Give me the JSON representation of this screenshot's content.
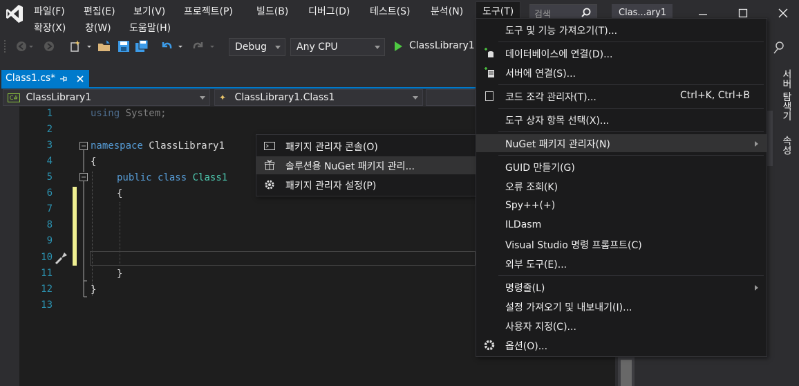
{
  "menubar": {
    "items": [
      "파일(F)",
      "편집(E)",
      "보기(V)",
      "프로젝트(P)",
      "빌드(B)",
      "디버그(D)",
      "테스트(S)",
      "분석(N)",
      "도구(T)"
    ],
    "row2": [
      "확장(X)",
      "창(W)",
      "도움말(H)"
    ],
    "search_placeholder": "검색",
    "window_title": "Clas...ary1"
  },
  "toolbar": {
    "config": "Debug",
    "platform": "Any CPU",
    "start_target": "ClassLibrary1"
  },
  "document": {
    "tab_label": "Class1.cs*",
    "project_combo": "ClassLibrary1",
    "class_combo": "ClassLibrary1.Class1"
  },
  "editor": {
    "line_numbers": [
      "1",
      "2",
      "3",
      "4",
      "5",
      "6",
      "7",
      "8",
      "9",
      "10",
      "11",
      "12",
      "13"
    ],
    "using_kw": "using",
    "using_ns": "System;",
    "ns_kw": "namespace",
    "ns_name": "ClassLibrary1",
    "open1": "{",
    "public_kw": "public",
    "class_kw": "class",
    "class_name": "Class1",
    "open2": "{",
    "close2": "}",
    "close1": "}"
  },
  "tools_menu": {
    "items": [
      {
        "label": "도구 및 기능 가져오기(T)...",
        "shortcut": "",
        "icon": ""
      },
      {
        "label": "데이터베이스에 연결(D)...",
        "shortcut": "",
        "icon": "database-connect-icon"
      },
      {
        "label": "서버에 연결(S)...",
        "shortcut": "",
        "icon": "server-connect-icon"
      },
      {
        "label": "코드 조각 관리자(T)...",
        "shortcut": "Ctrl+K, Ctrl+B",
        "icon": "snippet-icon"
      },
      {
        "label": "도구 상자 항목 선택(X)...",
        "shortcut": "",
        "icon": ""
      },
      {
        "label": "NuGet 패키지 관리자(N)",
        "shortcut": "",
        "icon": ""
      },
      {
        "label": "GUID 만들기(G)",
        "shortcut": "",
        "icon": ""
      },
      {
        "label": "오류 조회(K)",
        "shortcut": "",
        "icon": ""
      },
      {
        "label": "Spy++(+)",
        "shortcut": "",
        "icon": ""
      },
      {
        "label": "ILDasm",
        "shortcut": "",
        "icon": ""
      },
      {
        "label": "Visual Studio 명령 프롬프트(C)",
        "shortcut": "",
        "icon": ""
      },
      {
        "label": "외부 도구(E)...",
        "shortcut": "",
        "icon": ""
      },
      {
        "label": "명령줄(L)",
        "shortcut": "",
        "icon": ""
      },
      {
        "label": "설정 가져오기 및 내보내기(I)...",
        "shortcut": "",
        "icon": ""
      },
      {
        "label": "사용자 지정(C)...",
        "shortcut": "",
        "icon": ""
      },
      {
        "label": "옵션(O)...",
        "shortcut": "",
        "icon": "gear-icon"
      }
    ]
  },
  "nuget_submenu": {
    "items": [
      {
        "label": "패키지 관리자 콘솔(O)"
      },
      {
        "label": "솔루션용 NuGet 패키지 관리..."
      },
      {
        "label": "패키지 관리자 설정(P)"
      }
    ]
  },
  "side_panel": {
    "server_explorer": "서버 탐색기",
    "properties": "속성"
  },
  "colors": {
    "accent": "#007acc",
    "background": "#2d2d30",
    "editor": "#1e1e1e",
    "menu": "#1b1b1c"
  }
}
